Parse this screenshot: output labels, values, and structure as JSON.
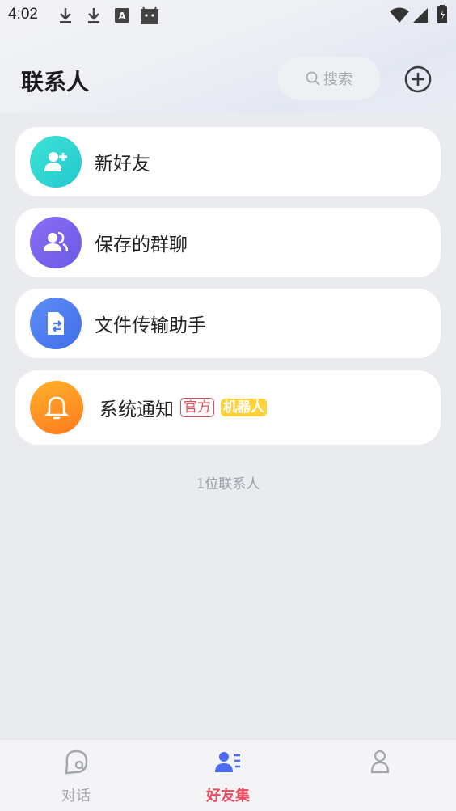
{
  "status_bar": {
    "time": "4:02"
  },
  "header": {
    "title": "联系人",
    "search_placeholder": "搜索"
  },
  "items": [
    {
      "label": "新好友",
      "icon": "add-user-icon"
    },
    {
      "label": "保存的群聊",
      "icon": "group-icon"
    },
    {
      "label": "文件传输助手",
      "icon": "file-transfer-icon"
    },
    {
      "label": "系统通知",
      "icon": "bell-icon",
      "tags": [
        "官方",
        "机器人"
      ]
    }
  ],
  "contact_count": "1位联系人",
  "bottom_nav": [
    {
      "label": "对话",
      "icon": "chat-icon",
      "active": false
    },
    {
      "label": "好友集",
      "icon": "contacts-icon",
      "active": true
    },
    {
      "label": "",
      "icon": "profile-icon",
      "active": false
    }
  ],
  "colors": {
    "accent": "#e84a5f",
    "inactive": "#a2a6ad"
  }
}
